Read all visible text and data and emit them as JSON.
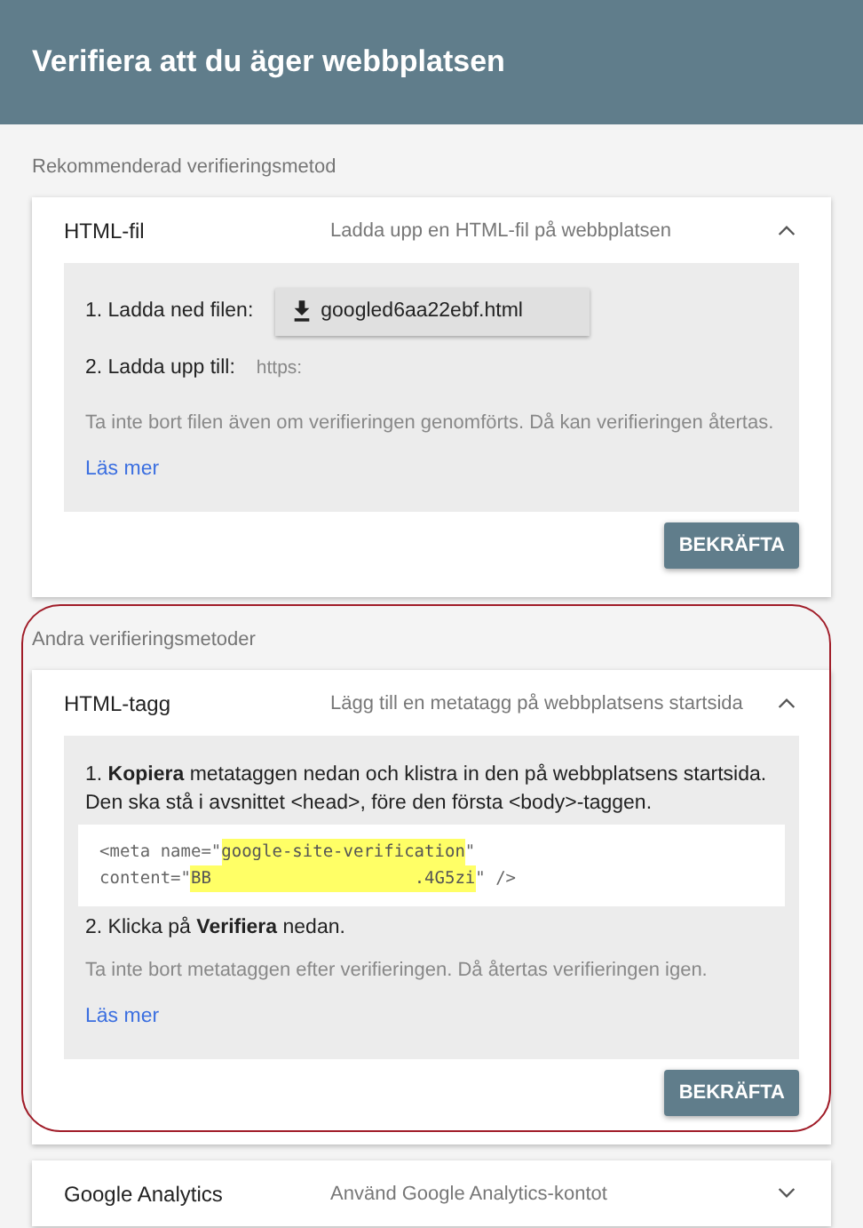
{
  "header": {
    "title": "Verifiera att du äger webbplatsen"
  },
  "sections": [
    {
      "label": "Rekommenderad verifieringsmetod",
      "cards": [
        {
          "title": "HTML-fil",
          "description": "Ladda upp en HTML-fil på webbplatsen",
          "expanded": true,
          "blocks": [
            {
              "kind": "download",
              "label": "1. Ladda ned filen:",
              "file": "googled6aa22ebf.html"
            },
            {
              "kind": "upload",
              "label": "2. Ladda upp till:",
              "value": "https:"
            },
            {
              "kind": "note",
              "text": "Ta inte bort filen även om verifieringen genomförts. Då kan verifieringen återtas."
            },
            {
              "kind": "link",
              "text": "Läs mer"
            }
          ],
          "button": "BEKRÄFTA"
        }
      ]
    },
    {
      "label": "Andra verifieringsmetoder",
      "annotated": true,
      "cards": [
        {
          "title": "HTML-tagg",
          "description": "Lägg till en metatagg på webbplatsens startsida",
          "expanded": true,
          "blocks": [
            {
              "kind": "step",
              "text": "1. **Kopiera** metataggen nedan och klistra in den på webbplatsens startsida. Den ska stå i avsnittet <head>, före den första <body>-taggen."
            },
            {
              "kind": "code",
              "lines": [
                [
                  {
                    "text": "<meta name=\"",
                    "highlighted": false
                  },
                  {
                    "text": "google-site-verification",
                    "highlighted": true
                  },
                  {
                    "text": "\"",
                    "highlighted": false
                  }
                ],
                [
                  {
                    "text": "content=\"",
                    "highlighted": false
                  },
                  {
                    "text": "BB                    .4G5zi",
                    "highlighted": true
                  },
                  {
                    "text": "\" />",
                    "highlighted": false
                  }
                ]
              ]
            },
            {
              "kind": "step",
              "text": "2. Klicka på **Verifiera** nedan."
            },
            {
              "kind": "note",
              "text": "Ta inte bort metataggen efter verifieringen. Då återtas verifieringen igen."
            },
            {
              "kind": "link",
              "text": "Läs mer"
            }
          ],
          "button": "BEKRÄFTA"
        },
        {
          "title": "Google Analytics",
          "description": "Använd Google Analytics-kontot",
          "expanded": false
        }
      ]
    }
  ]
}
